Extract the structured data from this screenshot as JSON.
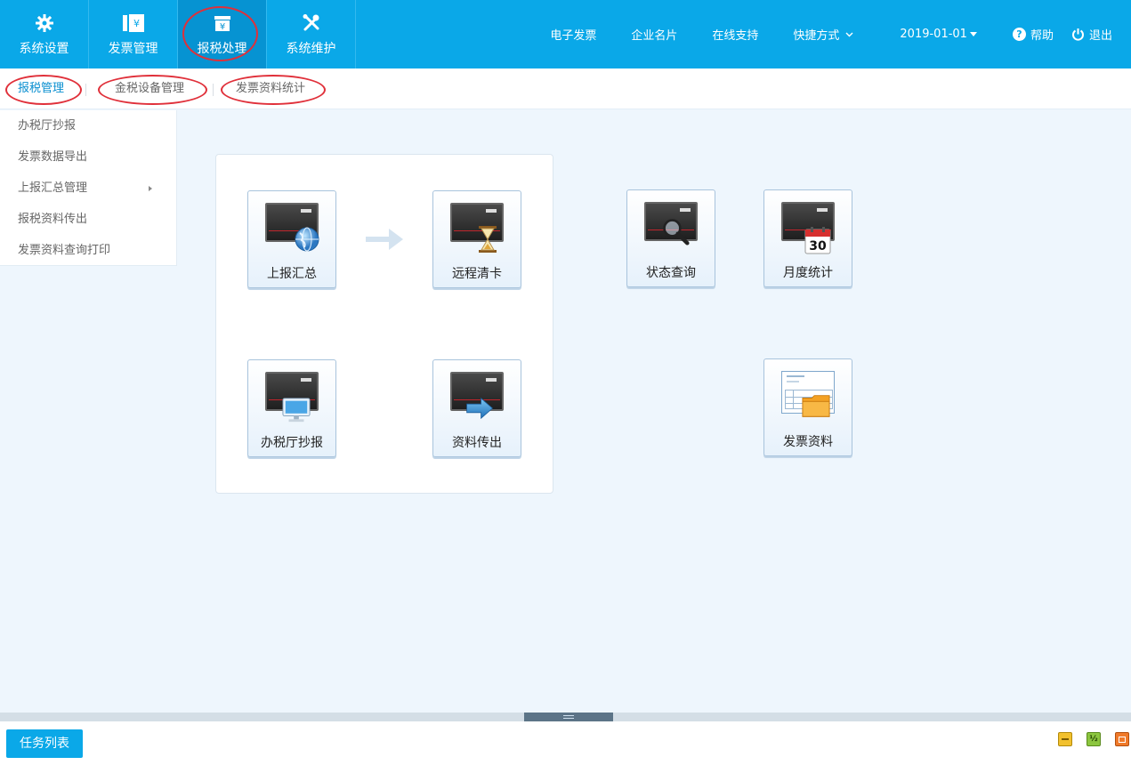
{
  "topnav": {
    "items": [
      {
        "label": "系统设置",
        "icon": "gear-icon"
      },
      {
        "label": "发票管理",
        "icon": "invoice-icon"
      },
      {
        "label": "报税处理",
        "icon": "tax-box-icon"
      },
      {
        "label": "系统维护",
        "icon": "tools-icon"
      }
    ],
    "active_index": 2
  },
  "toplinks": {
    "einvoice": "电子发票",
    "card": "企业名片",
    "support": "在线支持",
    "shortcut": "快捷方式",
    "date": "2019-01-01",
    "help": "帮助",
    "logout": "退出"
  },
  "subtabs": [
    {
      "label": "报税管理",
      "active": true
    },
    {
      "label": "金税设备管理",
      "active": false
    },
    {
      "label": "发票资料统计",
      "active": false
    }
  ],
  "leftmenu": [
    {
      "label": "办税厅抄报",
      "has_sub": false
    },
    {
      "label": "发票数据导出",
      "has_sub": false
    },
    {
      "label": "上报汇总管理",
      "has_sub": true
    },
    {
      "label": "报税资料传出",
      "has_sub": false
    },
    {
      "label": "发票资料查询打印",
      "has_sub": false
    }
  ],
  "tiles": {
    "report_summary": {
      "label": "上报汇总",
      "icon": "globe-icon"
    },
    "remote_clear": {
      "label": "远程清卡",
      "icon": "hourglass-icon"
    },
    "status_query": {
      "label": "状态查询",
      "icon": "magnifier-icon"
    },
    "monthly_stats": {
      "label": "月度统计",
      "icon": "calendar-icon",
      "calendar_day": "30"
    },
    "hall_copy": {
      "label": "办税厅抄报",
      "icon": "monitor-icon"
    },
    "data_export": {
      "label": "资料传出",
      "icon": "arrow-right-icon"
    },
    "invoice_data": {
      "label": "发票资料",
      "icon": "folder-icon"
    }
  },
  "bottombar": {
    "task_list": "任务列表",
    "win_buttons": [
      "minimize-icon",
      "half-icon",
      "maximize-icon"
    ],
    "half_label": "½"
  },
  "colors": {
    "primary": "#0aa8e8",
    "active_nav": "#0693d2",
    "highlight_circle": "#e0303a"
  }
}
